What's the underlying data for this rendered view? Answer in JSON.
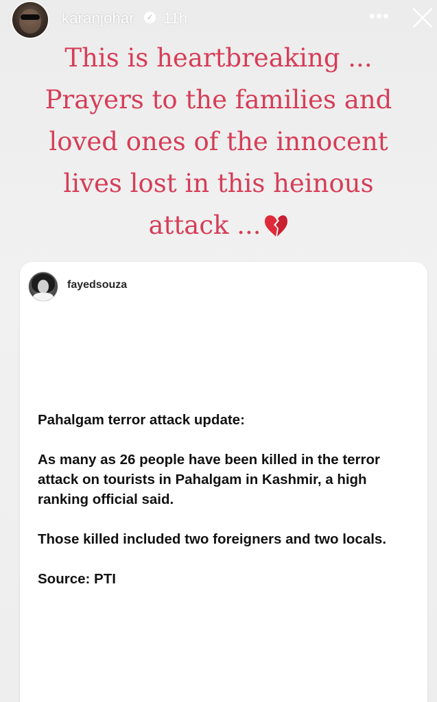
{
  "header": {
    "username": "karanjohar",
    "time": "11h",
    "more_label": "•••"
  },
  "caption": {
    "text": "This is heartbreaking ...\nPrayers to the families and\nloved ones of the innocent\nlives lost in this heinous\nattack ...",
    "emoji": "broken-heart-icon"
  },
  "shared_post": {
    "username": "fayedsouza",
    "headline": "Pahalgam terror attack update:",
    "paragraph1": "As many as 26 people have been killed in the terror attack on tourists in Pahalgam in Kashmir, a high ranking official said.",
    "paragraph2": "Those killed included two foreigners and two locals.",
    "source": "Source: PTI"
  },
  "colors": {
    "caption": "#d63d57",
    "background": "#eeeeee",
    "card": "#ffffff",
    "post_text": "#111111"
  }
}
